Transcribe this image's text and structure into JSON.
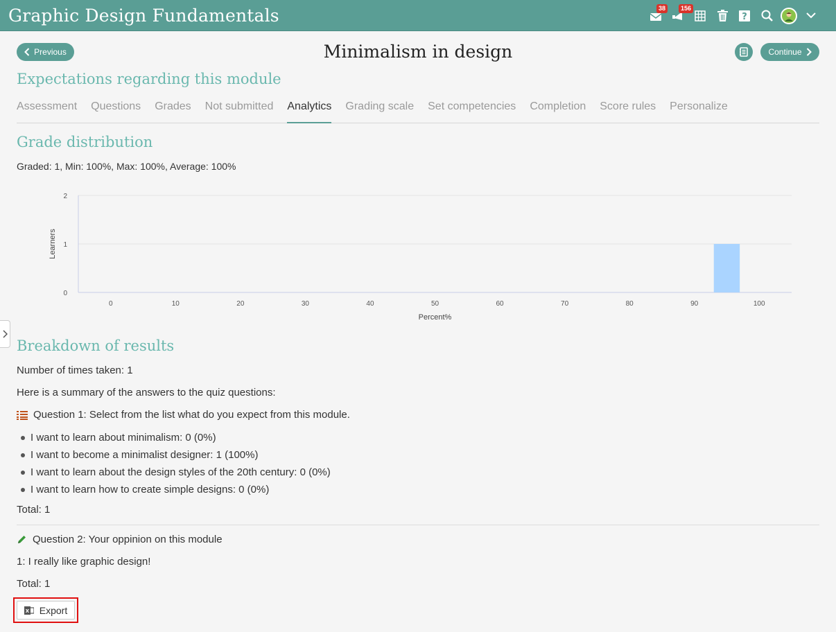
{
  "app": {
    "title": "Graphic Design Fundamentals"
  },
  "topbar": {
    "icons": [
      {
        "name": "messages-icon",
        "badge": "38"
      },
      {
        "name": "notifications-icon",
        "badge": "156"
      },
      {
        "name": "calendar-icon"
      },
      {
        "name": "trash-icon"
      },
      {
        "name": "help-icon"
      },
      {
        "name": "search-icon"
      },
      {
        "name": "user-avatar"
      },
      {
        "name": "chevron-down-icon"
      }
    ]
  },
  "nav": {
    "previous_label": "Previous",
    "continue_label": "Continue",
    "page_title": "Minimalism in design"
  },
  "module": {
    "heading": "Expectations regarding this module",
    "tabs": [
      {
        "label": "Assessment",
        "active": false
      },
      {
        "label": "Questions",
        "active": false
      },
      {
        "label": "Grades",
        "active": false
      },
      {
        "label": "Not submitted",
        "active": false
      },
      {
        "label": "Analytics",
        "active": true
      },
      {
        "label": "Grading scale",
        "active": false
      },
      {
        "label": "Set competencies",
        "active": false
      },
      {
        "label": "Completion",
        "active": false
      },
      {
        "label": "Score rules",
        "active": false
      },
      {
        "label": "Personalize",
        "active": false
      }
    ]
  },
  "grade_distribution": {
    "heading": "Grade distribution",
    "summary": "Graded: 1, Min: 100%, Max: 100%, Average: 100%"
  },
  "chart_data": {
    "type": "bar",
    "x": [
      95
    ],
    "values": [
      1
    ],
    "xlabel": "Percent%",
    "ylabel": "Learners",
    "xticks": [
      0,
      10,
      20,
      30,
      40,
      50,
      60,
      70,
      80,
      90,
      100
    ],
    "yticks": [
      0,
      1,
      2
    ],
    "xlim": [
      -5,
      105
    ],
    "ylim": [
      0,
      2
    ],
    "grid": true,
    "bar_color": "#aad4ff"
  },
  "breakdown": {
    "heading": "Breakdown of results",
    "times_taken": "Number of times taken: 1",
    "summary_intro": "Here is a summary of the answers to the quiz questions:",
    "q1_label": "Question 1",
    "q1_text": ": Select from the list what do you expect from this module.",
    "q1_answers": [
      "I want to learn about minimalism: 0 (0%)",
      "I want to become a minimalist designer: 1 (100%)",
      "I want to learn about the design styles of the 20th century: 0 (0%)",
      "I want to learn how to create simple designs: 0 (0%)"
    ],
    "q1_total": "Total: 1",
    "q2_label": "Question 2",
    "q2_text": ": Your oppinion on this module",
    "q2_answer": "1: I really like graphic design!",
    "q2_total": "Total: 1",
    "export_label": "Export"
  },
  "colors": {
    "topbar": "#5a9e95",
    "heading": "#6ab8ae",
    "badge": "#d9342b",
    "highlight": "#e01010"
  }
}
